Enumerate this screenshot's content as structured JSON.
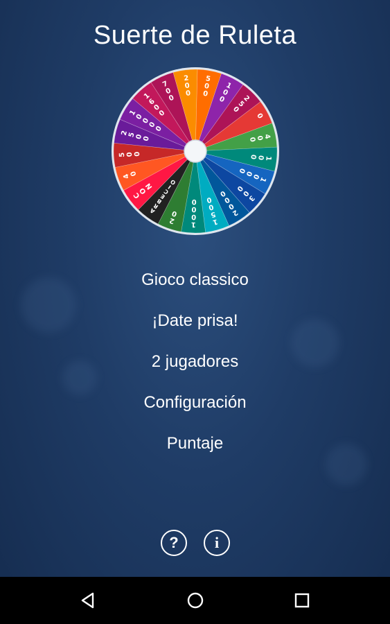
{
  "title": "Suerte de Ruleta",
  "wheel": {
    "segments": [
      {
        "label": "500",
        "color": "#ff6d00"
      },
      {
        "label": "100",
        "color": "#8e24aa"
      },
      {
        "label": "250",
        "color": "#ad1457"
      },
      {
        "label": "0",
        "color": "#e53935"
      },
      {
        "label": "400",
        "color": "#43a047"
      },
      {
        "label": "100",
        "color": "#00897b"
      },
      {
        "label": "1000",
        "color": "#1565c0"
      },
      {
        "label": "300",
        "color": "#0d47a1"
      },
      {
        "label": "2000",
        "color": "#01579b"
      },
      {
        "label": "1500",
        "color": "#00acc1"
      },
      {
        "label": "1000",
        "color": "#00897b"
      },
      {
        "label": "20",
        "color": "#2e7d32"
      },
      {
        "label": "ARBECIO",
        "color": "#212121"
      },
      {
        "label": "CON",
        "color": "#ff1744"
      },
      {
        "label": "40",
        "color": "#ff5722"
      },
      {
        "label": "500",
        "color": "#c62828"
      },
      {
        "label": "2500",
        "color": "#6a1b9a"
      },
      {
        "label": "10000",
        "color": "#7b1fa2"
      },
      {
        "label": "1600",
        "color": "#c2185b"
      },
      {
        "label": "700",
        "color": "#ad1457"
      },
      {
        "label": "200",
        "color": "#fb8c00"
      }
    ]
  },
  "menu": [
    {
      "label": "Gioco classico"
    },
    {
      "label": "¡Date prisa!"
    },
    {
      "label": "2 jugadores"
    },
    {
      "label": "Configuración"
    },
    {
      "label": "Puntaje"
    }
  ],
  "footer": {
    "help_symbol": "?",
    "info_symbol": "i"
  },
  "navbar": {
    "back_icon": "back-triangle-icon",
    "home_icon": "home-circle-icon",
    "recents_icon": "recents-square-icon"
  }
}
